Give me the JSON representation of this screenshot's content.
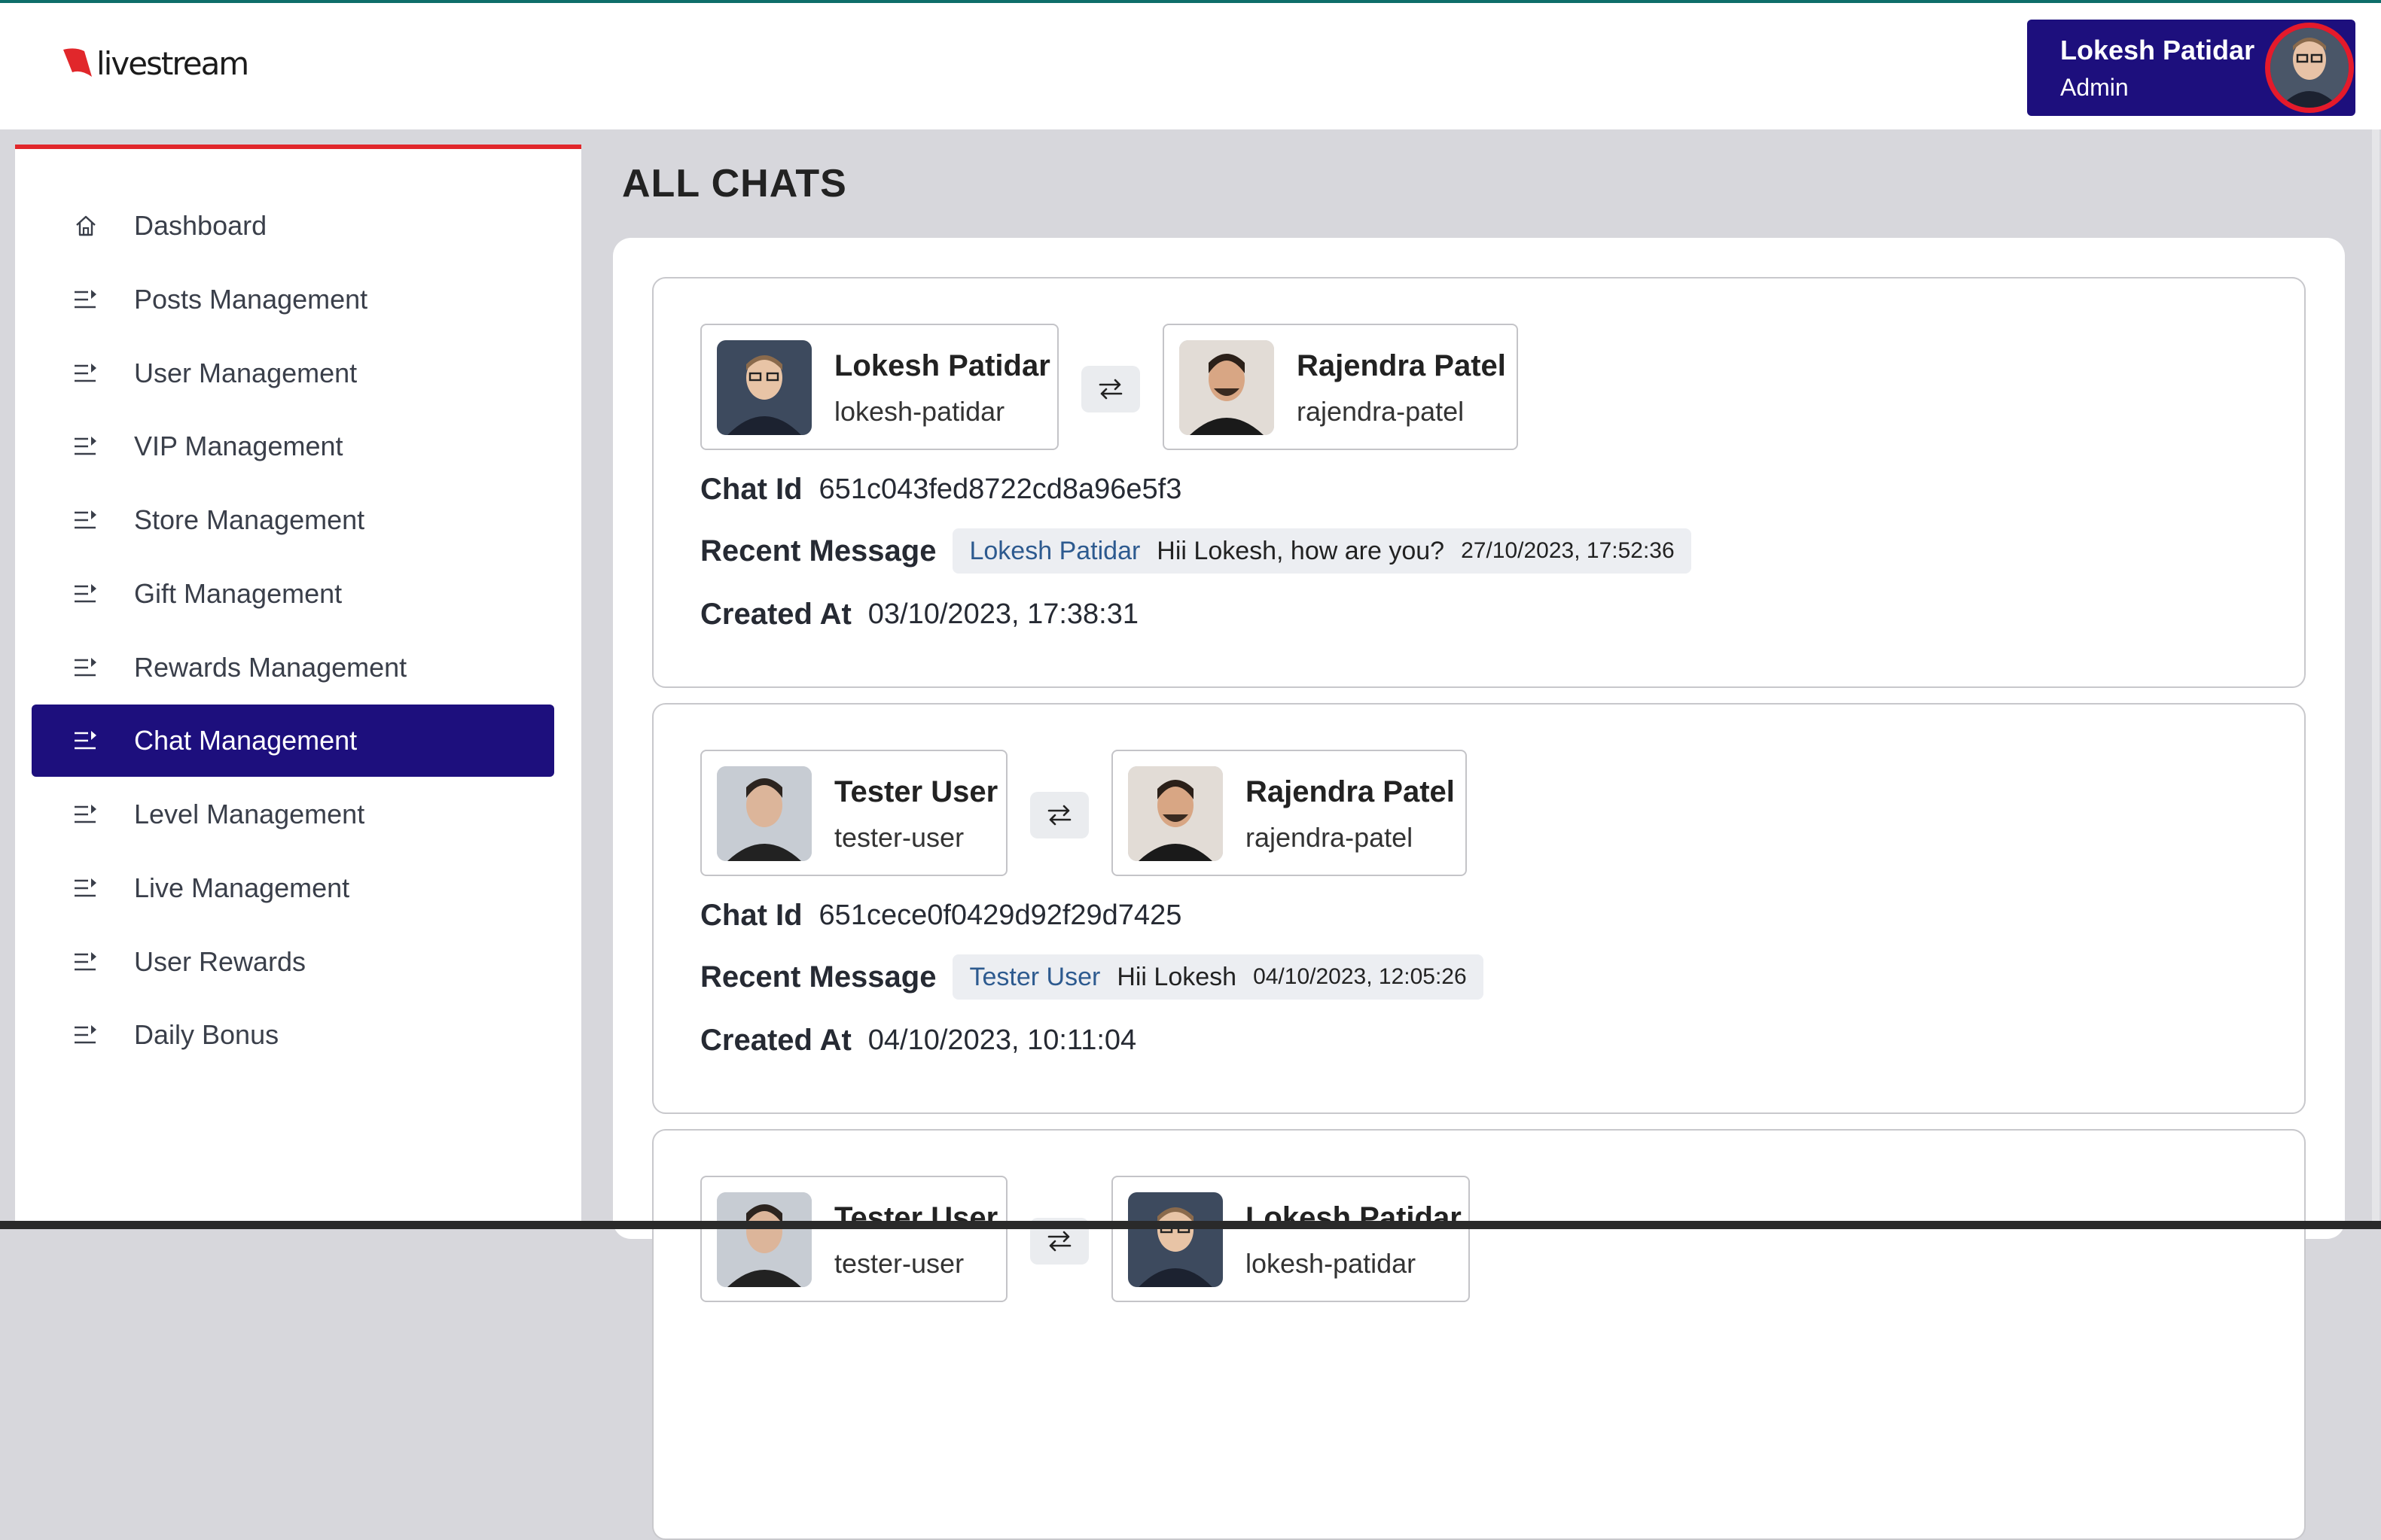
{
  "app": {
    "logo_text": "livestream",
    "brand_color": "#e1272b",
    "accent_color": "#1d0f7d"
  },
  "profile": {
    "name": "Lokesh Patidar",
    "role": "Admin",
    "avatar_icon": "user-avatar"
  },
  "sidebar": {
    "items": [
      {
        "label": "Dashboard",
        "icon": "home-icon",
        "active": false
      },
      {
        "label": "Posts Management",
        "icon": "list-arrow-icon",
        "active": false
      },
      {
        "label": "User Management",
        "icon": "list-arrow-icon",
        "active": false
      },
      {
        "label": "VIP Management",
        "icon": "list-arrow-icon",
        "active": false
      },
      {
        "label": "Store Management",
        "icon": "list-arrow-icon",
        "active": false
      },
      {
        "label": "Gift Management",
        "icon": "list-arrow-icon",
        "active": false
      },
      {
        "label": "Rewards Management",
        "icon": "list-arrow-icon",
        "active": false
      },
      {
        "label": "Chat Management",
        "icon": "list-arrow-icon",
        "active": true
      },
      {
        "label": "Level Management",
        "icon": "list-arrow-icon",
        "active": false
      },
      {
        "label": "Live Management",
        "icon": "list-arrow-icon",
        "active": false
      },
      {
        "label": "User Rewards",
        "icon": "list-arrow-icon",
        "active": false
      },
      {
        "label": "Daily Bonus",
        "icon": "list-arrow-icon",
        "active": false
      }
    ]
  },
  "main": {
    "title": "ALL CHATS",
    "labels": {
      "chat_id": "Chat Id",
      "recent_message": "Recent Message",
      "created_at": "Created At"
    },
    "chats": [
      {
        "user_a": {
          "name": "Lokesh Patidar",
          "handle": "lokesh-patidar"
        },
        "user_b": {
          "name": "Rajendra Patel",
          "handle": "rajendra-patel"
        },
        "chat_id": "651c043fed8722cd8a96e5f3",
        "recent_sender": "Lokesh Patidar",
        "recent_text": "Hii Lokesh, how are you?",
        "recent_time": "27/10/2023, 17:52:36",
        "created_at": "03/10/2023, 17:38:31"
      },
      {
        "user_a": {
          "name": "Tester User",
          "handle": "tester-user"
        },
        "user_b": {
          "name": "Rajendra Patel",
          "handle": "rajendra-patel"
        },
        "chat_id": "651cece0f0429d92f29d7425",
        "recent_sender": "Tester User",
        "recent_text": "Hii Lokesh",
        "recent_time": "04/10/2023, 12:05:26",
        "created_at": "04/10/2023, 10:11:04"
      },
      {
        "user_a": {
          "name": "Tester User",
          "handle": "tester-user"
        },
        "user_b": {
          "name": "Lokesh Patidar",
          "handle": "lokesh-patidar"
        }
      }
    ]
  }
}
